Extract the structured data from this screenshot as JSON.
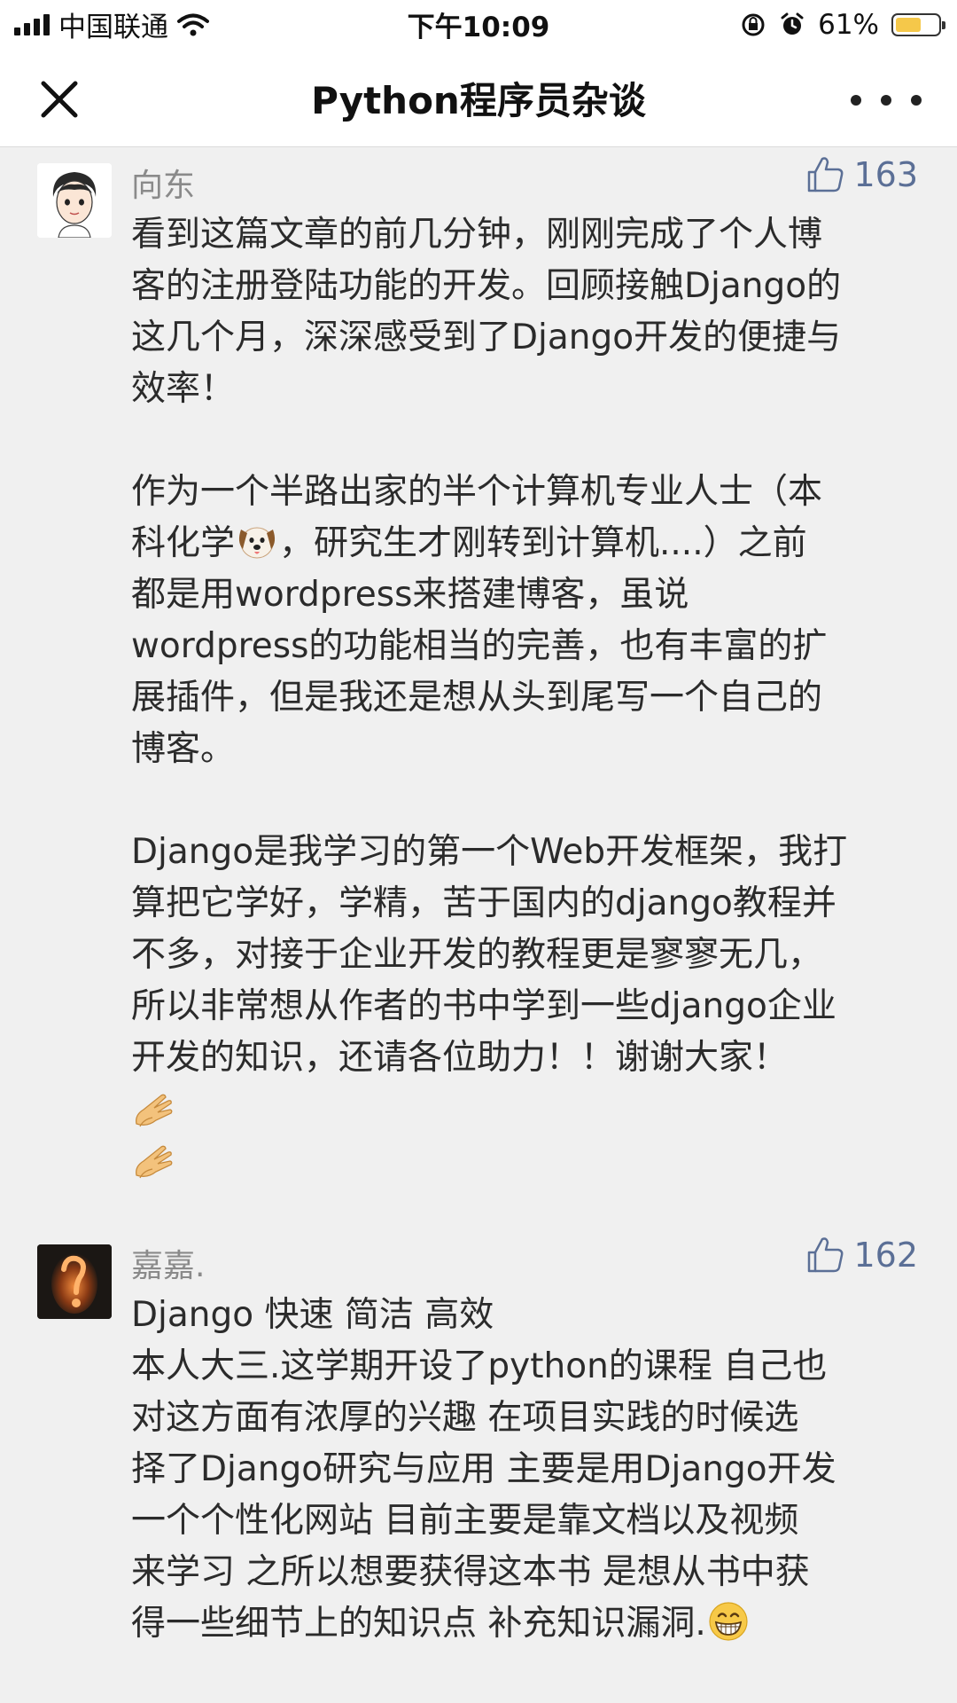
{
  "status_bar": {
    "carrier": "中国联通",
    "time": "下午10:09",
    "battery": "61%",
    "battery_level": 0.61,
    "icons": [
      "signal-icon",
      "wifi-icon",
      "orientation-lock-icon",
      "alarm-icon",
      "battery-icon"
    ]
  },
  "nav": {
    "title": "Python程序员杂谈",
    "left_icon": "close-icon",
    "right_icon": "more-icon"
  },
  "comments": [
    {
      "author": "向东",
      "likes": "163",
      "lines": [
        "看到这篇文章的前几分钟，刚刚完成了个人博",
        "客的注册登陆功能的开发。回顾接触Django的",
        "这几个月，深深感受到了Django开发的便捷与",
        "效率！",
        "",
        "作为一个半路出家的半个计算机专业人士（本",
        "科化学",
        "，研究生才刚转到计算机....）之前",
        "都是用wordpress来搭建博客，虽说",
        "wordpress的功能相当的完善，也有丰富的扩",
        "展插件，但是我还是想从头到尾写一个自己的",
        "博客。",
        "",
        "Django是我学习的第一个Web开发框架，我打",
        "算把它学好，学精，苦于国内的django教程并",
        "不多，对接于企业开发的教程更是寥寥无几，",
        "所以非常想从作者的书中学到一些django企业",
        "开发的知识，还请各位助力！！谢谢大家！"
      ],
      "emoji": [
        "dog-face-icon",
        "clapping-hands-icon",
        "clapping-hands-icon"
      ]
    },
    {
      "author": "嘉嘉.",
      "likes": "162",
      "lines": [
        "Django 快速 简洁 高效",
        "本人大三.这学期开设了python的课程 自己也",
        "对这方面有浓厚的兴趣 在项目实践的时候选",
        "择了Django研究与应用 主要是用Django开发",
        "一个个性化网站  目前主要是靠文档以及视频",
        "来学习 之所以想要获得这本书 是想从书中获",
        "得一些细节上的知识点 补充知识漏洞."
      ],
      "emoji": [
        "grinning-face-icon"
      ]
    }
  ]
}
